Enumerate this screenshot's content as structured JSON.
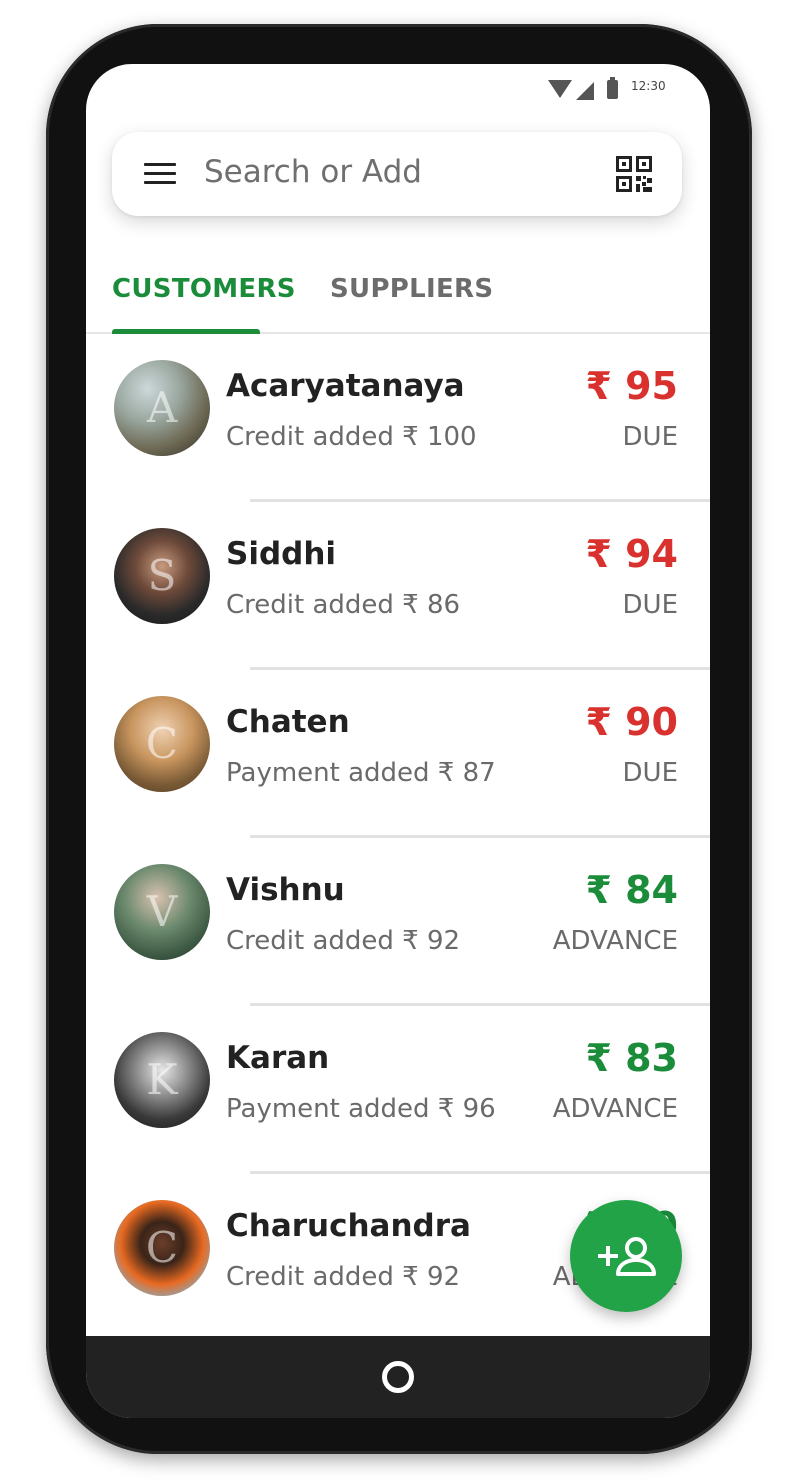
{
  "status_bar": {
    "time": "12:30"
  },
  "search": {
    "placeholder": "Search or Add"
  },
  "tabs": [
    {
      "label": "CUSTOMERS",
      "active": true
    },
    {
      "label": "SUPPLIERS",
      "active": false
    }
  ],
  "customers": [
    {
      "initial": "A",
      "name": "Acaryatanaya",
      "subtitle": "Credit added ₹ 100",
      "amount": "₹ 95",
      "status": "DUE"
    },
    {
      "initial": "S",
      "name": "Siddhi",
      "subtitle": "Credit added ₹ 86",
      "amount": "₹ 94",
      "status": "DUE"
    },
    {
      "initial": "C",
      "name": "Chaten",
      "subtitle": "Payment added ₹ 87",
      "amount": "₹ 90",
      "status": "DUE"
    },
    {
      "initial": "V",
      "name": "Vishnu",
      "subtitle": "Credit added ₹ 92",
      "amount": "₹ 84",
      "status": "ADVANCE"
    },
    {
      "initial": "K",
      "name": "Karan",
      "subtitle": "Payment added ₹ 96",
      "amount": "₹ 83",
      "status": "ADVANCE"
    },
    {
      "initial": "C",
      "name": "Charuchandra",
      "subtitle": "Credit added ₹ 92",
      "amount": "₹ 80",
      "status": "ADVANCE"
    }
  ],
  "colors": {
    "accent": "#1a8c3a",
    "due": "#d9322e",
    "advance": "#1a8c3a",
    "fab": "#23a347"
  },
  "icons": {
    "menu": "menu-icon",
    "qr": "qr-code-icon",
    "fab": "add-person-icon",
    "home": "home-button"
  }
}
